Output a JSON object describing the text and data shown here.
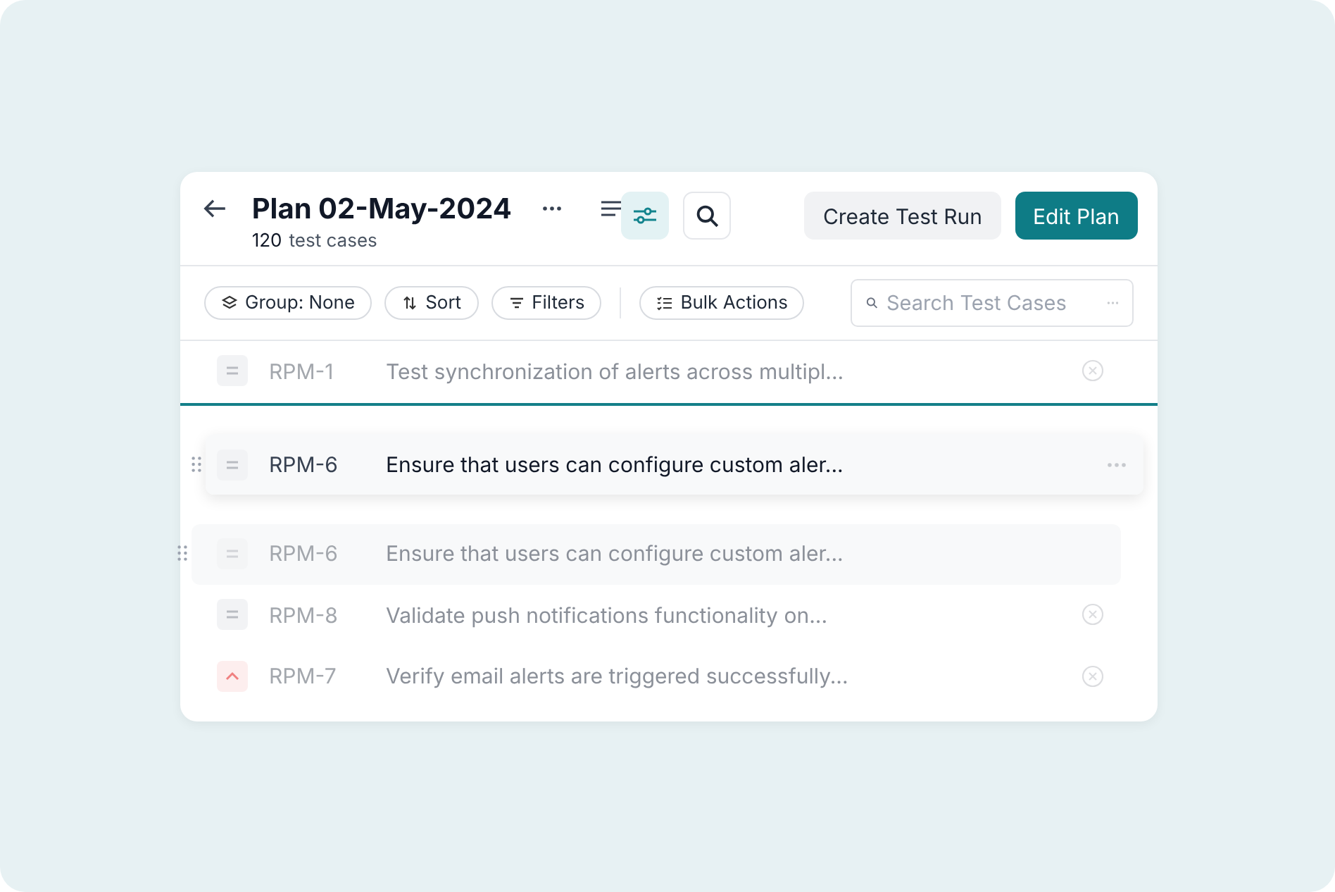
{
  "header": {
    "title": "Plan 02-May-2024",
    "count": "120",
    "count_label": "test cases",
    "buttons": [
      {
        "label": "Create Test Run",
        "kind": "secondary"
      },
      {
        "label": "Edit Plan",
        "kind": "primary"
      }
    ],
    "view_toggle": {
      "selected": true
    }
  },
  "toolbar": {
    "chips": [
      {
        "label": "Group: None",
        "kind": "group"
      },
      {
        "label": "Sort",
        "kind": "sort"
      },
      {
        "label": "Filters",
        "kind": "filter"
      },
      {
        "label": "Bulk Actions",
        "kind": "bulk"
      }
    ],
    "search": {
      "placeholder": "Search Test Cases"
    }
  },
  "rows": [
    {
      "kind": "row",
      "id": "RPM-1",
      "title": "Test synchronization of alerts across multipl...",
      "marker": {
        "kind": "medium"
      },
      "drop_target": true
    },
    {
      "kind": "placeholder",
      "id": "RPM-6",
      "title": "Ensure that users can configure custom aler...",
      "marker": {
        "kind": "medium"
      }
    },
    {
      "kind": "row",
      "id": "RPM-8",
      "title": "Validate push notifications functionality on...",
      "marker": {
        "kind": "medium"
      },
      "drop_target": false
    },
    {
      "kind": "row",
      "id": "RPM-7",
      "title": "Verify email alerts are triggered successfully...",
      "marker": {
        "kind": "high"
      },
      "drop_target": false
    }
  ],
  "dragged": {
    "id": "RPM-6",
    "title": "Ensure that users can configure custom aler...",
    "marker": {
      "kind": "medium"
    }
  }
}
